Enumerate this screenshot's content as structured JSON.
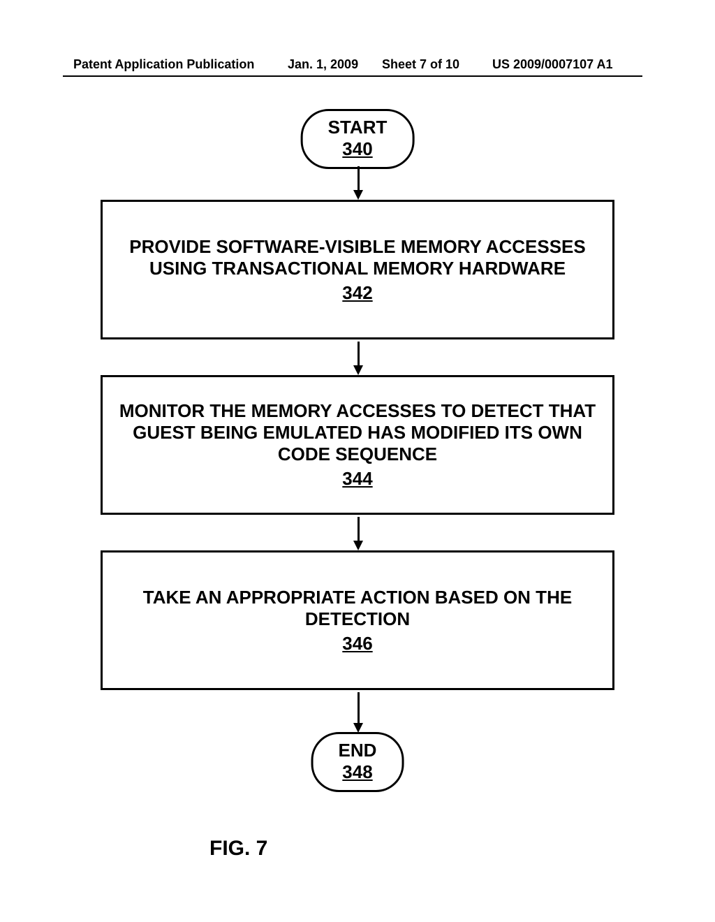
{
  "header": {
    "publication": "Patent Application Publication",
    "date": "Jan. 1, 2009",
    "sheet": "Sheet 7 of 10",
    "docnum": "US 2009/0007107 A1"
  },
  "flow": {
    "start": {
      "label": "START",
      "ref": "340"
    },
    "steps": [
      {
        "text": "PROVIDE SOFTWARE-VISIBLE MEMORY ACCESSES USING TRANSACTIONAL MEMORY HARDWARE",
        "ref": "342"
      },
      {
        "text": "MONITOR THE MEMORY ACCESSES TO DETECT THAT GUEST BEING EMULATED HAS MODIFIED ITS OWN CODE SEQUENCE",
        "ref": "344"
      },
      {
        "text": "TAKE AN APPROPRIATE ACTION BASED ON THE DETECTION",
        "ref": "346"
      }
    ],
    "end": {
      "label": "END",
      "ref": "348"
    }
  },
  "figure": "FIG. 7"
}
